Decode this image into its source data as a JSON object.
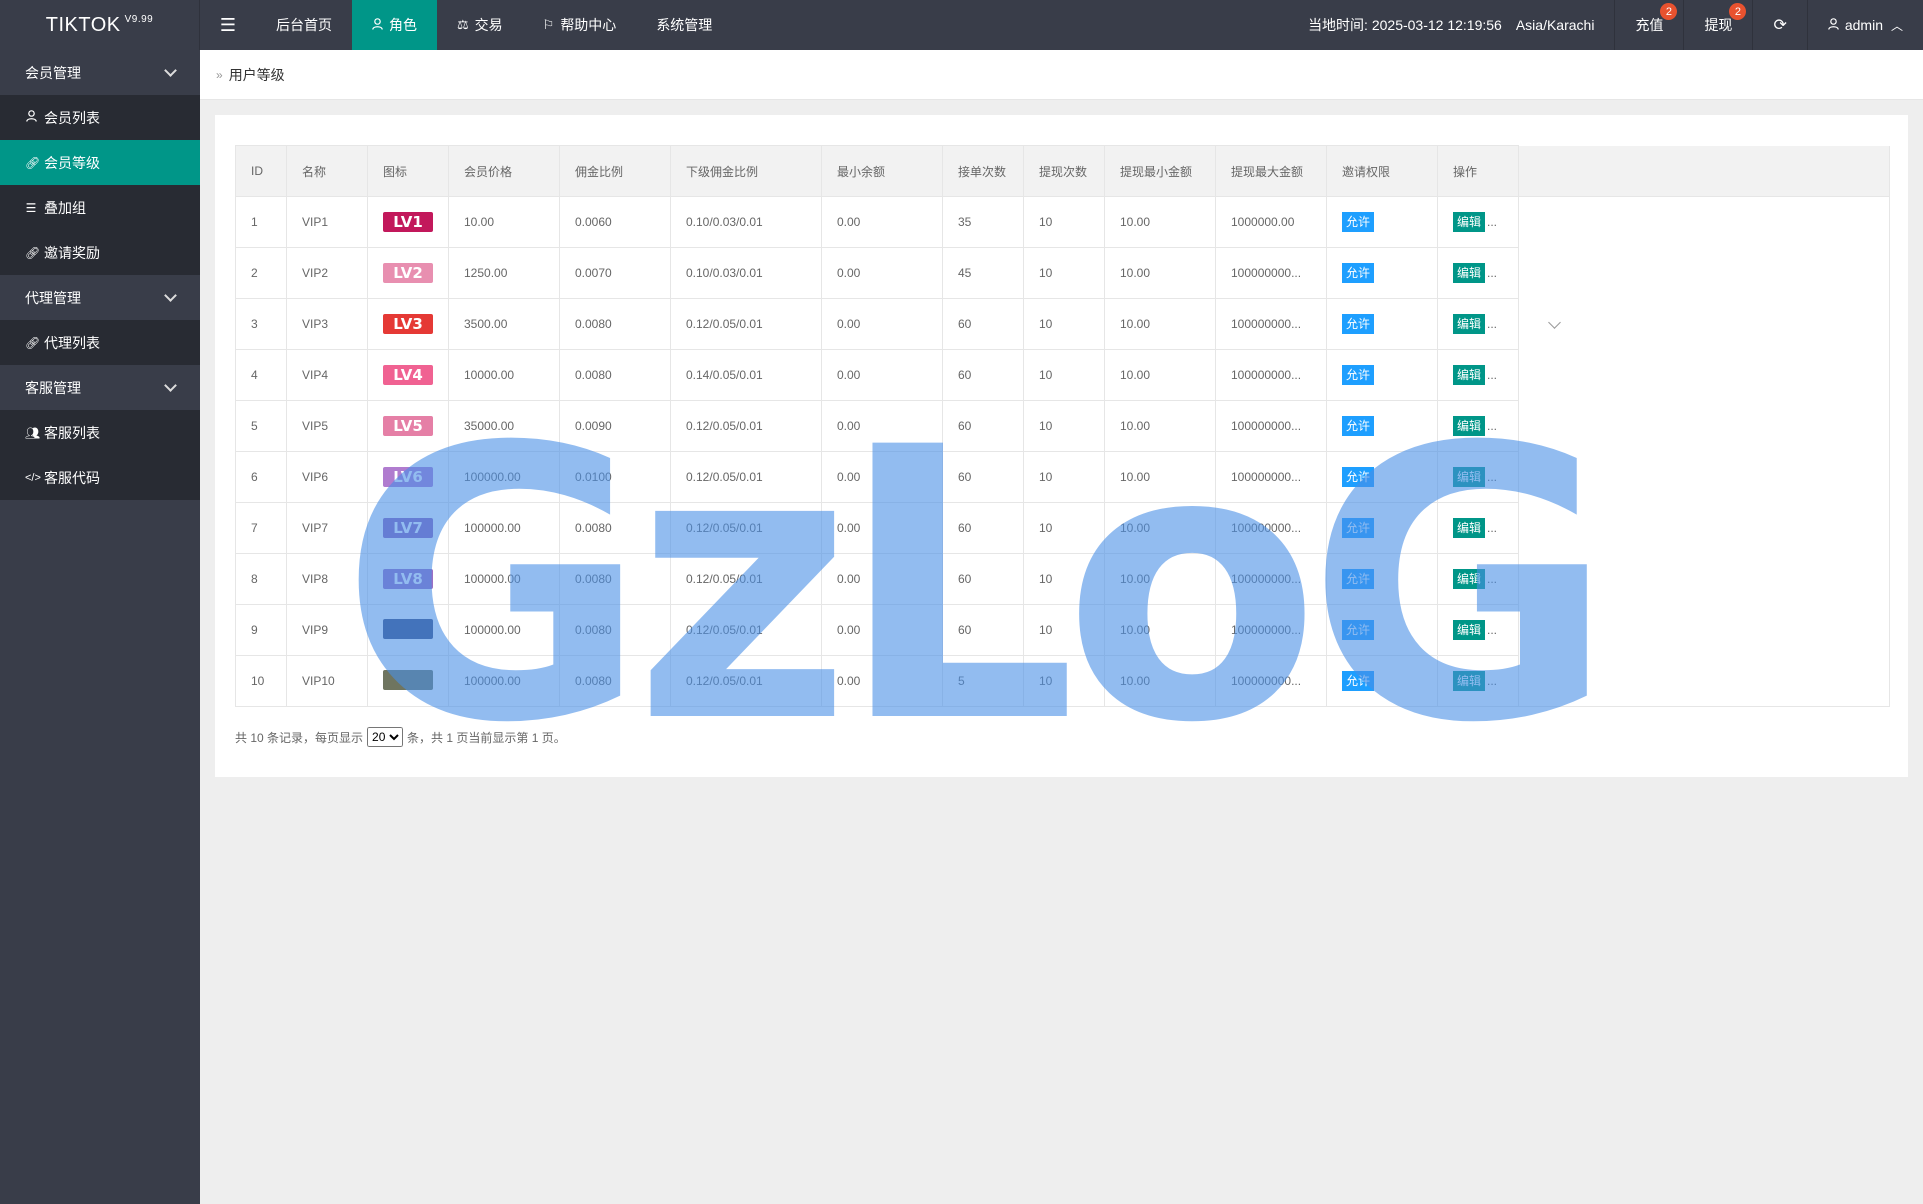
{
  "app": {
    "brand": "TIKTOK",
    "version": "V9.99"
  },
  "topnav": {
    "menu_icon": "hamburger-icon",
    "items": [
      {
        "label": "后台首页",
        "icon": ""
      },
      {
        "label": "角色",
        "icon": "user-icon",
        "active": true
      },
      {
        "label": "交易",
        "icon": "balance-scale-icon"
      },
      {
        "label": "帮助中心",
        "icon": "flag-icon"
      },
      {
        "label": "系统管理",
        "icon": ""
      }
    ]
  },
  "topright": {
    "time_label": "当地时间: 2025-03-12 12:19:56",
    "timezone": "Asia/Karachi",
    "recharge_label": "充值",
    "recharge_badge": "2",
    "withdraw_label": "提现",
    "withdraw_badge": "2",
    "user_label": "admin"
  },
  "sidebar": {
    "groups": [
      {
        "label": "会员管理",
        "items": [
          {
            "label": "会员列表",
            "icon": "user-icon"
          },
          {
            "label": "会员等级",
            "icon": "link-icon",
            "active": true
          },
          {
            "label": "叠加组",
            "icon": "list-icon"
          },
          {
            "label": "邀请奖励",
            "icon": "link-icon"
          }
        ]
      },
      {
        "label": "代理管理",
        "items": [
          {
            "label": "代理列表",
            "icon": "link-icon"
          }
        ]
      },
      {
        "label": "客服管理",
        "items": [
          {
            "label": "客服列表",
            "icon": "users-icon"
          },
          {
            "label": "客服代码",
            "icon": "code-icon"
          }
        ]
      }
    ]
  },
  "breadcrumb": {
    "current": "用户等级"
  },
  "table": {
    "columns": [
      "ID",
      "名称",
      "图标",
      "会员价格",
      "佣金比例",
      "下级佣金比例",
      "最小余额",
      "接单次数",
      "提现次数",
      "提现最小金额",
      "提现最大金额",
      "邀请权限",
      "操作"
    ],
    "allow_label": "允许",
    "edit_label": "编辑",
    "more": "...",
    "rows": [
      {
        "id": "1",
        "name": "VIP1",
        "badge": "LV1",
        "badge_color": "#c2185b",
        "price": "10.00",
        "commission": "0.0060",
        "sub_commission": "0.10/0.03/0.01",
        "min_balance": "0.00",
        "orders": "35",
        "withdraw_times": "10",
        "withdraw_min": "10.00",
        "withdraw_max": "1000000.00"
      },
      {
        "id": "2",
        "name": "VIP2",
        "badge": "LV2",
        "badge_color": "#e88fb0",
        "price": "1250.00",
        "commission": "0.0070",
        "sub_commission": "0.10/0.03/0.01",
        "min_balance": "0.00",
        "orders": "45",
        "withdraw_times": "10",
        "withdraw_min": "10.00",
        "withdraw_max": "100000000..."
      },
      {
        "id": "3",
        "name": "VIP3",
        "badge": "LV3",
        "badge_color": "#e53935",
        "price": "3500.00",
        "commission": "0.0080",
        "sub_commission": "0.12/0.05/0.01",
        "min_balance": "0.00",
        "orders": "60",
        "withdraw_times": "10",
        "withdraw_min": "10.00",
        "withdraw_max": "100000000..."
      },
      {
        "id": "4",
        "name": "VIP4",
        "badge": "LV4",
        "badge_color": "#f06292",
        "price": "10000.00",
        "commission": "0.0080",
        "sub_commission": "0.14/0.05/0.01",
        "min_balance": "0.00",
        "orders": "60",
        "withdraw_times": "10",
        "withdraw_min": "10.00",
        "withdraw_max": "100000000..."
      },
      {
        "id": "5",
        "name": "VIP5",
        "badge": "LV5",
        "badge_color": "#e57fa6",
        "price": "35000.00",
        "commission": "0.0090",
        "sub_commission": "0.12/0.05/0.01",
        "min_balance": "0.00",
        "orders": "60",
        "withdraw_times": "10",
        "withdraw_min": "10.00",
        "withdraw_max": "100000000..."
      },
      {
        "id": "6",
        "name": "VIP6",
        "badge": "LV6",
        "badge_color": "#b07ccf",
        "price": "100000.00",
        "commission": "0.0100",
        "sub_commission": "0.12/0.05/0.01",
        "min_balance": "0.00",
        "orders": "60",
        "withdraw_times": "10",
        "withdraw_min": "10.00",
        "withdraw_max": "100000000..."
      },
      {
        "id": "7",
        "name": "VIP7",
        "badge": "LV7",
        "badge_color": "#8e63b8",
        "price": "100000.00",
        "commission": "0.0080",
        "sub_commission": "0.12/0.05/0.01",
        "min_balance": "0.00",
        "orders": "60",
        "withdraw_times": "10",
        "withdraw_min": "10.00",
        "withdraw_max": "100000000..."
      },
      {
        "id": "8",
        "name": "VIP8",
        "badge": "LV8",
        "badge_color": "#9b6fc4",
        "price": "100000.00",
        "commission": "0.0080",
        "sub_commission": "0.12/0.05/0.01",
        "min_balance": "0.00",
        "orders": "60",
        "withdraw_times": "10",
        "withdraw_min": "10.00",
        "withdraw_max": "100000000..."
      },
      {
        "id": "9",
        "name": "VIP9",
        "badge": "",
        "badge_color": "#3b4a7a",
        "price": "100000.00",
        "commission": "0.0080",
        "sub_commission": "0.12/0.05/0.01",
        "min_balance": "0.00",
        "orders": "60",
        "withdraw_times": "10",
        "withdraw_min": "10.00",
        "withdraw_max": "100000000..."
      },
      {
        "id": "10",
        "name": "VIP10",
        "badge": "",
        "badge_color": "#6f7560",
        "price": "100000.00",
        "commission": "0.0080",
        "sub_commission": "0.12/0.05/0.01",
        "min_balance": "0.00",
        "orders": "5",
        "withdraw_times": "10",
        "withdraw_min": "10.00",
        "withdraw_max": "100000000..."
      }
    ]
  },
  "pager": {
    "prefix": "共 10 条记录，每页显示",
    "page_size": "20",
    "suffix": "条，共 1 页当前显示第 1 页。"
  },
  "watermark": {
    "text": "GzLoG"
  },
  "colors": {
    "accent": "#009688",
    "allow": "#1e9fff",
    "dark": "#393d49",
    "badge": "#e8522f"
  }
}
